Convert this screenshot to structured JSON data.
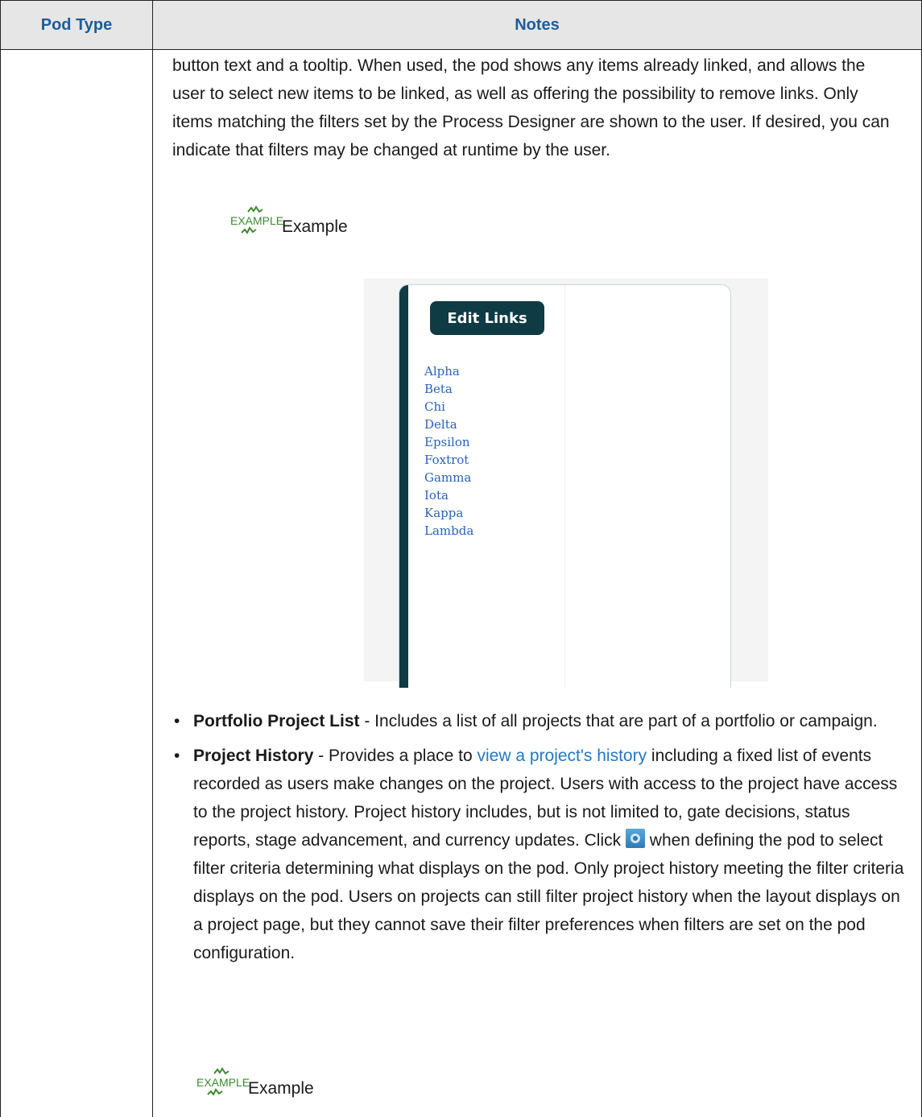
{
  "table": {
    "headers": {
      "pod_type": "Pod Type",
      "notes": "Notes"
    }
  },
  "intro_paragraph": "button text and a tooltip. When used, the pod shows any items already linked, and allows the user to select new items to be linked, as well as offering the possibility to remove links. Only items matching the filters set by the Process Designer are shown to the user. If desired, you can indicate that filters may be changed at runtime by the user.",
  "example_icon_text": "EXAMPLE",
  "example_label": "Example",
  "screenshot": {
    "button_label": "Edit Links",
    "links": [
      "Alpha",
      "Beta",
      "Chi",
      "Delta",
      "Epsilon",
      "Foxtrot",
      "Gamma",
      "Iota",
      "Kappa",
      "Lambda"
    ]
  },
  "bullets": [
    {
      "title": "Portfolio Project List",
      "text": " - Includes a list of all projects that are part of a portfolio or campaign."
    },
    {
      "title": "Project History",
      "text_before_link": " - Provides a place to ",
      "link": "view a project's history",
      "text_before_icon": " including a fixed list of events recorded as users make changes on the project. Users with access to the project have access to the project history. Project history includes, but is not limited to, gate decisions, status reports, stage advancement, and currency updates. Click ",
      "icon": "gear-icon",
      "text_after_icon": " when defining the pod to select filter criteria determining what displays on the pod. Only project history meeting the filter criteria displays on the pod. Users on projects can still filter project history when the layout displays on a project page, but they cannot save their filter preferences when filters are set on the pod configuration."
    }
  ],
  "colors": {
    "header_text": "#1d5c99",
    "header_bg": "#e6e6e6",
    "link": "#2478c4",
    "example_icon": "#3c8a2e",
    "button_bg": "#0e3b44"
  }
}
